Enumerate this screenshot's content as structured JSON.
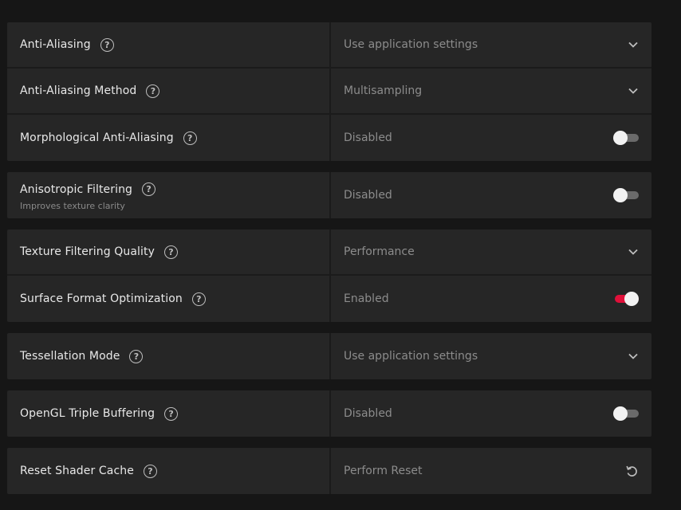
{
  "groups": [
    {
      "rows": [
        {
          "label": "Anti-Aliasing",
          "value": "Use application settings",
          "control": "dropdown"
        },
        {
          "label": "Anti-Aliasing Method",
          "value": "Multisampling",
          "control": "dropdown"
        },
        {
          "label": "Morphological Anti-Aliasing",
          "value": "Disabled",
          "control": "toggle",
          "enabled": false
        }
      ]
    },
    {
      "rows": [
        {
          "label": "Anisotropic Filtering",
          "subtitle": "Improves texture clarity",
          "value": "Disabled",
          "control": "toggle",
          "enabled": false
        }
      ]
    },
    {
      "rows": [
        {
          "label": "Texture Filtering Quality",
          "value": "Performance",
          "control": "dropdown"
        },
        {
          "label": "Surface Format Optimization",
          "value": "Enabled",
          "control": "toggle",
          "enabled": true
        }
      ]
    },
    {
      "rows": [
        {
          "label": "Tessellation Mode",
          "value": "Use application settings",
          "control": "dropdown"
        }
      ]
    },
    {
      "rows": [
        {
          "label": "OpenGL Triple Buffering",
          "value": "Disabled",
          "control": "toggle",
          "enabled": false
        }
      ]
    },
    {
      "rows": [
        {
          "label": "Reset Shader Cache",
          "value": "Perform Reset",
          "control": "reset"
        }
      ]
    }
  ],
  "help_glyph": "?",
  "icons": {
    "help": "question-circle-icon",
    "dropdown": "chevron-down-icon",
    "reset": "reset-arrow-icon"
  },
  "colors": {
    "accent": "#e0103a",
    "background": "#161616",
    "panel": "#262626"
  }
}
